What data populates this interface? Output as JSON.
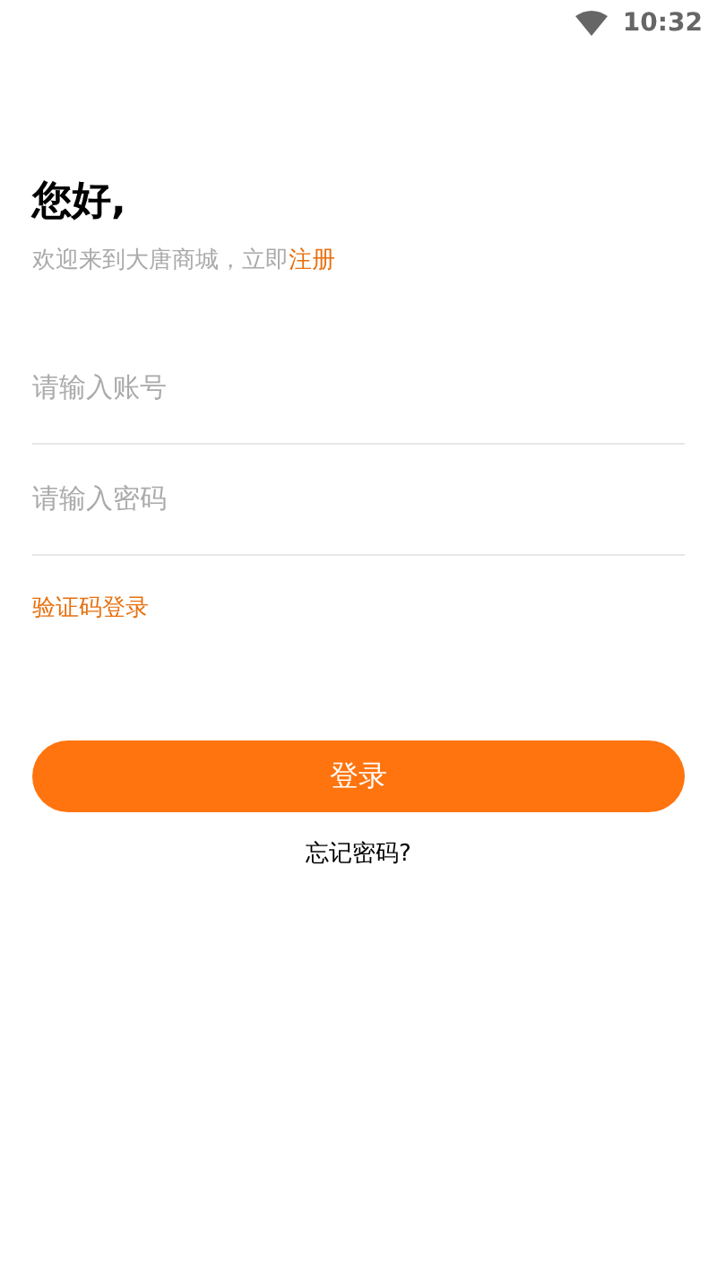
{
  "status_bar": {
    "time": "10:32"
  },
  "greeting": "您好,",
  "welcome": {
    "text": "欢迎来到大唐商城，立即",
    "link": "注册"
  },
  "fields": [
    {
      "placeholder": "请输入账号"
    },
    {
      "placeholder": "请输入密码"
    }
  ],
  "code_login_link": "验证码登录",
  "login_button": "登录",
  "forgot_password_link": "忘记密码?"
}
